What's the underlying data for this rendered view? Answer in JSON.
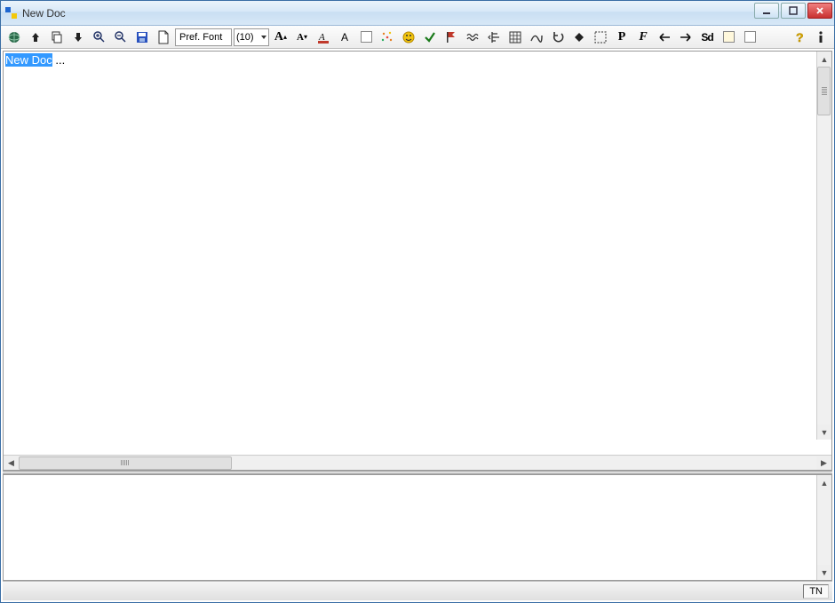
{
  "window": {
    "title": "New Doc"
  },
  "toolbar": {
    "font_label": "Pref. Font",
    "size_label": "(10)"
  },
  "document": {
    "selected_text": "New Doc",
    "trailing_text": " ..."
  },
  "statusbar": {
    "mode": "TN"
  },
  "icons": {
    "globe": "globe",
    "up": "up-arrow",
    "copy": "copy",
    "down": "down-arrow",
    "zoom_in": "zoom-in",
    "zoom_out": "zoom-out",
    "save": "save",
    "page": "page",
    "font_incr": "font-increase",
    "font_decr": "font-decrease",
    "font_color": "font-color",
    "font_a": "font-plain",
    "box1": "checkbox-1",
    "sparkle": "sparkle",
    "smiley": "smiley",
    "check": "checkmark",
    "flag": "flag",
    "wave": "wave",
    "align": "align",
    "grid": "grid",
    "curve": "curve",
    "undo": "undo",
    "diamond": "diamond",
    "marquee": "marquee",
    "p_button": "p-glyph",
    "f_button": "f-glyph",
    "arrow_left": "arrow-left",
    "arrow_right": "arrow-right",
    "sd": "sd-glyph",
    "box2": "color-box",
    "box3": "checkbox-2",
    "help": "help",
    "info": "info"
  }
}
